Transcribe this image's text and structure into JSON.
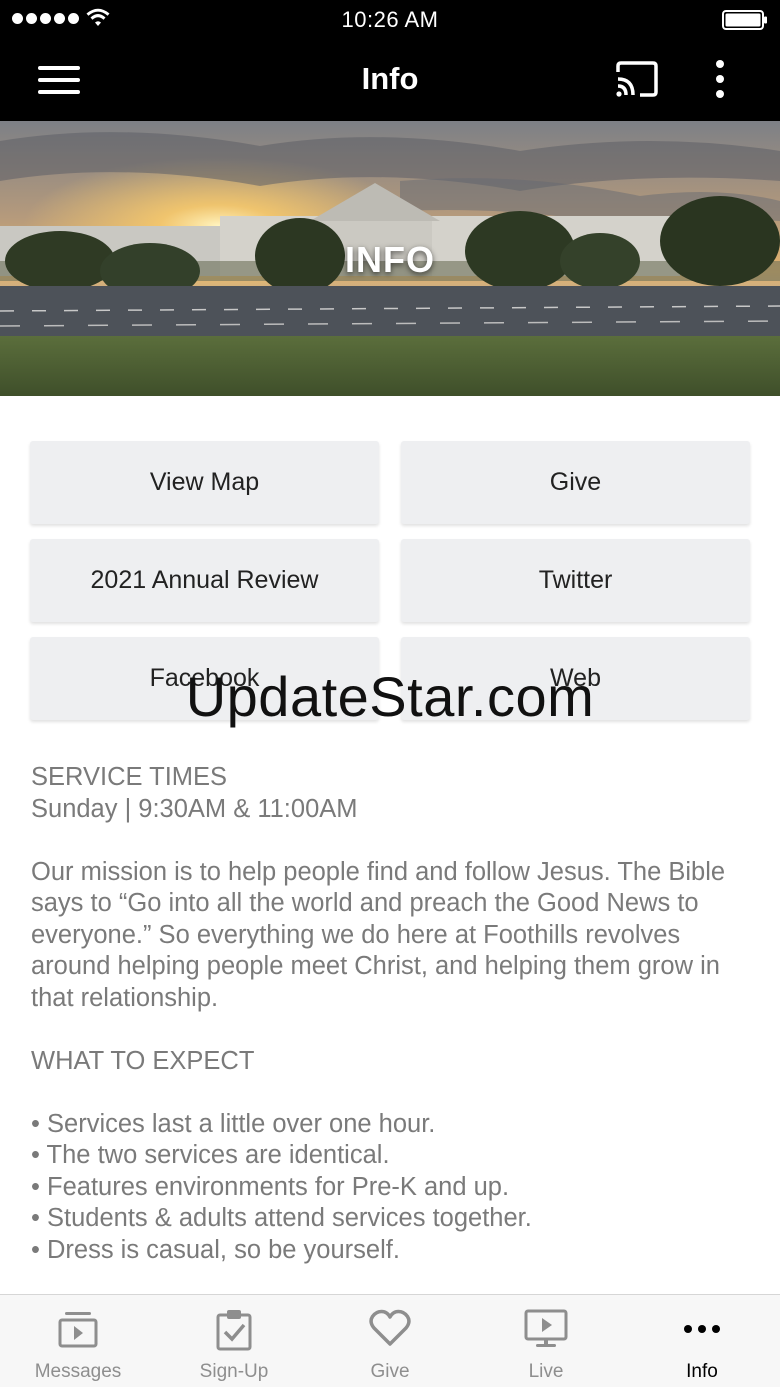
{
  "status_bar": {
    "time": "10:26 AM"
  },
  "nav": {
    "title": "Info",
    "menu_icon": "hamburger-menu-icon",
    "cast_icon": "cast-icon",
    "more_icon": "more-vertical-icon"
  },
  "hero": {
    "title": "INFO"
  },
  "buttons": [
    {
      "label": "View Map"
    },
    {
      "label": "Give"
    },
    {
      "label": "2021 Annual Review"
    },
    {
      "label": "Twitter"
    },
    {
      "label": "Facebook"
    },
    {
      "label": "Web"
    }
  ],
  "watermark": "UpdateStar.com",
  "content": {
    "service_heading": "SERVICE TIMES",
    "service_times": "Sunday | 9:30AM & 11:00AM",
    "mission": "Our mission is to help people find and follow Jesus. The Bible says to “Go into all the world and preach the Good News to everyone.” So everything we do here at Foothills revolves around helping people meet Christ, and helping them grow in that relationship.",
    "expect_heading": "WHAT TO EXPECT",
    "expect_items": [
      "• Services last a little over one hour.",
      "• The two services are identical.",
      "• Features environments for Pre-K and up.",
      "• Students & adults attend services together.",
      "• Dress is casual, so be yourself."
    ]
  },
  "tabs": [
    {
      "label": "Messages",
      "icon": "messages-icon"
    },
    {
      "label": "Sign-Up",
      "icon": "clipboard-check-icon"
    },
    {
      "label": "Give",
      "icon": "heart-icon"
    },
    {
      "label": "Live",
      "icon": "tv-play-icon"
    },
    {
      "label": "Info",
      "icon": "more-horizontal-icon",
      "active": true
    }
  ],
  "colors": {
    "bar_background": "#000000",
    "button_background": "#eeeff1",
    "body_text": "#7a7a7a",
    "tab_inactive": "#8e8e8e",
    "tab_active": "#000000"
  }
}
